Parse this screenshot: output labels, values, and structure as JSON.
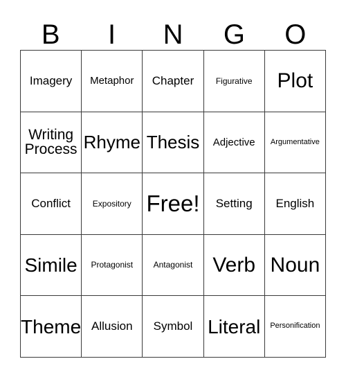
{
  "card": {
    "title": "BINGO",
    "background_color": "#ffffff",
    "border_color": "#3a3a3a",
    "text_color": "#000000"
  },
  "header": {
    "letters": [
      {
        "label": "B"
      },
      {
        "label": "I"
      },
      {
        "label": "N"
      },
      {
        "label": "G"
      },
      {
        "label": "O"
      }
    ]
  },
  "grid": {
    "columns": 5,
    "rows": 5,
    "free_space": "Free!",
    "cells": [
      {
        "label": "Imagery",
        "size": "fs-xs"
      },
      {
        "label": "Metaphor",
        "size": "fs-xxs"
      },
      {
        "label": "Chapter",
        "size": "fs-xs"
      },
      {
        "label": "Figurative",
        "size": "fs-tiny"
      },
      {
        "label": "Plot",
        "size": "fs-xl"
      },
      {
        "label": "Writing\nProcess",
        "size": "fs-sm"
      },
      {
        "label": "Rhyme",
        "size": "fs-md"
      },
      {
        "label": "Thesis",
        "size": "fs-md"
      },
      {
        "label": "Adjective",
        "size": "fs-xxs"
      },
      {
        "label": "Argumentative",
        "size": "fs-micro"
      },
      {
        "label": "Conflict",
        "size": "fs-xs"
      },
      {
        "label": "Expository",
        "size": "fs-tiny"
      },
      {
        "label": "Free!",
        "size": "fs-xxl"
      },
      {
        "label": "Setting",
        "size": "fs-xs"
      },
      {
        "label": "English",
        "size": "fs-xs"
      },
      {
        "label": "Simile",
        "size": "fs-lg"
      },
      {
        "label": "Protagonist",
        "size": "fs-tiny"
      },
      {
        "label": "Antagonist",
        "size": "fs-tiny"
      },
      {
        "label": "Verb",
        "size": "fs-xl"
      },
      {
        "label": "Noun",
        "size": "fs-xl"
      },
      {
        "label": "Theme",
        "size": "fs-lg"
      },
      {
        "label": "Allusion",
        "size": "fs-xs"
      },
      {
        "label": "Symbol",
        "size": "fs-xs"
      },
      {
        "label": "Literal",
        "size": "fs-lg"
      },
      {
        "label": "Personification",
        "size": "fs-micro"
      }
    ]
  }
}
